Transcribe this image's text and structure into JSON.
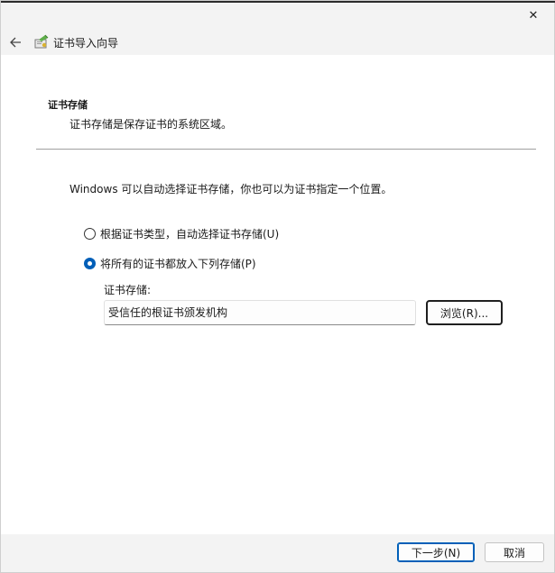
{
  "window": {
    "close_glyph": "✕",
    "title": "证书导入向导"
  },
  "header": {
    "back_icon": "back-arrow-icon",
    "wizard_icon": "certificate-icon"
  },
  "section": {
    "title": "证书存储",
    "description": "证书存储是保存证书的系统区域。"
  },
  "intro": "Windows 可以自动选择证书存储，你也可以为证书指定一个位置。",
  "options": [
    {
      "label": "根据证书类型，自动选择证书存储(U)",
      "checked": false
    },
    {
      "label": "将所有的证书都放入下列存储(P)",
      "checked": true
    }
  ],
  "store": {
    "label": "证书存储:",
    "value": "受信任的根证书颁发机构",
    "browse_label": "浏览(R)..."
  },
  "footer": {
    "next_label": "下一步(N)",
    "cancel_label": "取消"
  },
  "colors": {
    "accent": "#005fb8",
    "content_bg": "#ffffff",
    "chrome_bg": "#f3f3f3"
  }
}
